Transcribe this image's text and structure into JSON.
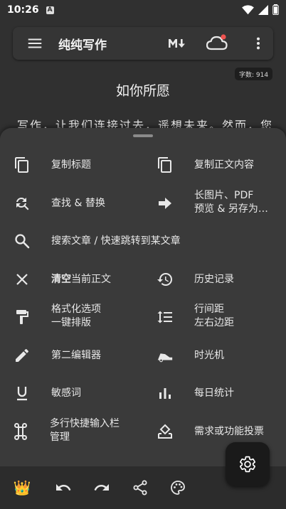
{
  "status_bar": {
    "time": "10:26",
    "notification_glyph": "A"
  },
  "toolbar": {
    "title": "纯纯写作",
    "icons": [
      "menu-icon",
      "markdown-icon",
      "cloud-icon",
      "more-vert-icon"
    ],
    "sync_badge_color": "#ef5350"
  },
  "editor": {
    "word_count": "字数: 914",
    "title": "如你所愿",
    "first_line": "写作，让我们连接过去，遥想未来。然而，您"
  },
  "menu": {
    "items": [
      {
        "id": "copy-title",
        "label": "复制标题",
        "icon": "copy-icon"
      },
      {
        "id": "copy-body",
        "label": "复制正文内容",
        "icon": "copy-icon"
      },
      {
        "id": "find-replace",
        "label": "查找 & 替换",
        "icon": "find-replace-icon"
      },
      {
        "id": "export",
        "line1": "长图片、PDF",
        "line2": "预览 & 另存为…",
        "icon": "arrow-right-icon"
      },
      {
        "id": "search-jump",
        "label": "搜索文章 / 快速跳转到某文章",
        "icon": "search-icon"
      },
      {
        "id": "clear",
        "bold": "清空",
        "rest": "当前正文",
        "icon": "close-icon"
      },
      {
        "id": "history",
        "label": "历史记录",
        "icon": "history-icon"
      },
      {
        "id": "format",
        "line1": "格式化选项",
        "line2": "一键排版",
        "icon": "paint-roller-icon"
      },
      {
        "id": "spacing",
        "line1": "行间距",
        "line2": "左右边距",
        "icon": "line-spacing-icon"
      },
      {
        "id": "second-editor",
        "label": "第二编辑器",
        "icon": "pencil-icon"
      },
      {
        "id": "time-machine",
        "label": "时光机",
        "icon": "time-machine-icon"
      },
      {
        "id": "sensitive",
        "label": "敏感词",
        "icon": "underline-icon"
      },
      {
        "id": "daily-stats",
        "label": "每日统计",
        "icon": "bar-chart-icon"
      },
      {
        "id": "shortcut-bar",
        "line1": "多行快捷输入栏",
        "line2": "管理",
        "icon": "command-icon"
      },
      {
        "id": "feature-vote",
        "label": "需求或功能投票",
        "icon": "vote-icon"
      }
    ]
  },
  "bottom_bar": {
    "icons": [
      "crown-icon",
      "undo-icon",
      "redo-icon",
      "share-icon",
      "palette-icon"
    ],
    "crown_glyph": "👑",
    "fab_icon": "settings-icon"
  }
}
